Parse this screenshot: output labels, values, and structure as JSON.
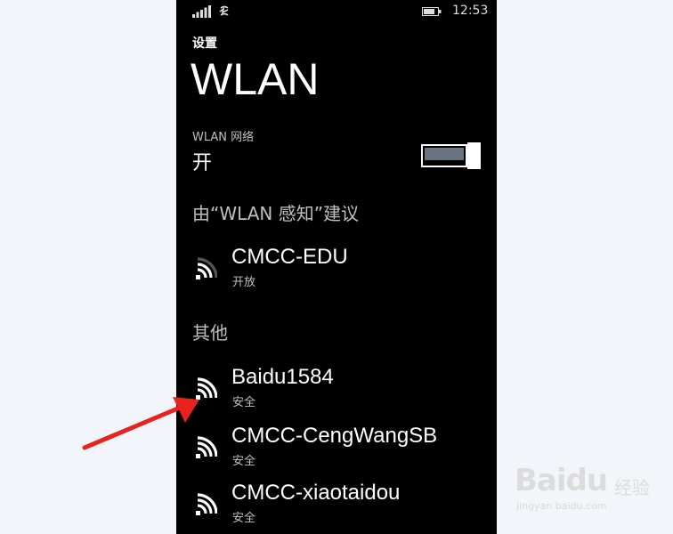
{
  "status_bar": {
    "time": "12:53"
  },
  "header": {
    "settings_label": "设置",
    "title": "WLAN"
  },
  "wlan_toggle": {
    "label": "WLAN 网络",
    "state_label": "开",
    "on": true
  },
  "suggested": {
    "header": "由“WLAN 感知”建议",
    "networks": [
      {
        "name": "CMCC-EDU",
        "status": "开放"
      }
    ]
  },
  "others": {
    "header": "其他",
    "networks": [
      {
        "name": "Baidu1584",
        "status": "安全"
      },
      {
        "name": "CMCC-CengWangSB",
        "status": "安全"
      },
      {
        "name": "CMCC-xiaotaidou",
        "status": "安全"
      }
    ]
  },
  "watermark": {
    "logo": "Baidu",
    "product": "经验",
    "url": "jingyan.baidu.com"
  },
  "colors": {
    "arrow": "#e8231d",
    "phone_bg": "#000000",
    "page_bg": "#f2f6fb",
    "toggle_fill": "#6a7480"
  },
  "icons": {
    "signal": "signal-bars-icon",
    "wifi": "wifi-icon",
    "battery": "battery-icon",
    "arrow": "red-arrow"
  }
}
